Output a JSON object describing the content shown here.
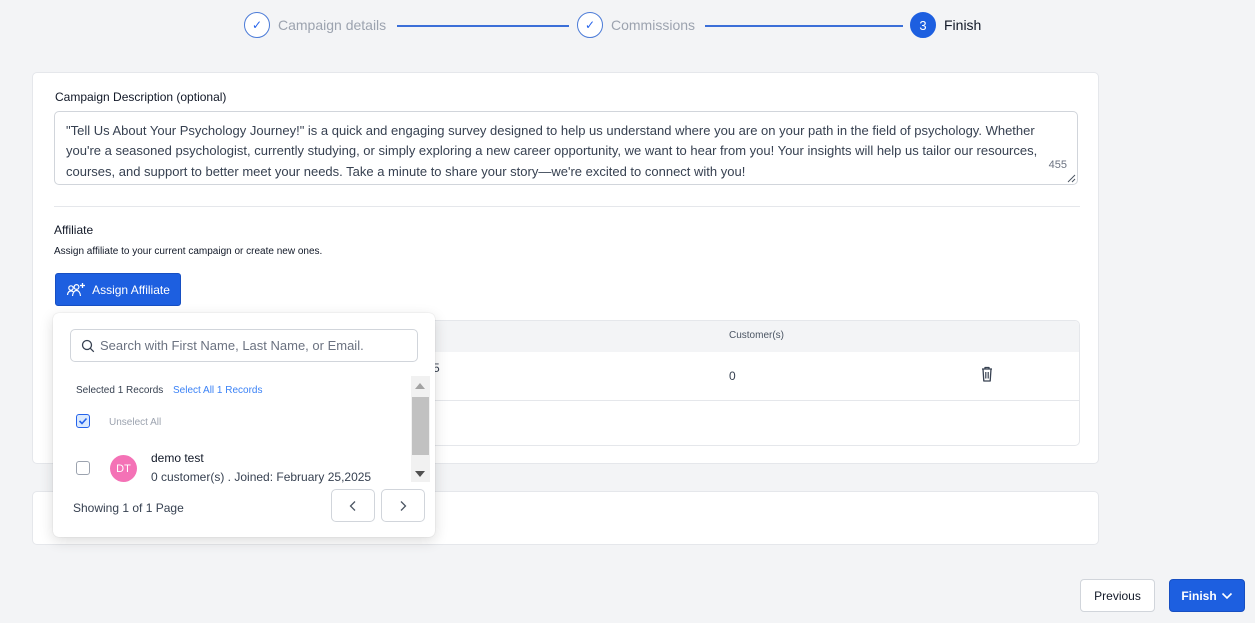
{
  "stepper": {
    "steps": [
      {
        "label": "Campaign details",
        "marker": "✓",
        "state": "done"
      },
      {
        "label": "Commissions",
        "marker": "✓",
        "state": "done"
      },
      {
        "label": "Finish",
        "marker": "3",
        "state": "active"
      }
    ]
  },
  "description": {
    "label": "Campaign Description (optional)",
    "text": "\"Tell Us About Your Psychology Journey!\" is a quick and engaging survey designed to help us understand where you are on your path in the field of psychology. Whether you're a seasoned psychologist, currently studying, or simply exploring a new career opportunity, we want to hear from you! Your insights will help us tailor our resources, courses, and support to better meet your needs. Take a minute to share your story—we're excited to connect with you!",
    "char_count": "455"
  },
  "affiliate": {
    "title": "Affiliate",
    "subtitle": "Assign affiliate to your current campaign or create new ones.",
    "assign_button": "Assign Affiliate",
    "table": {
      "header_customers": "Customer(s)",
      "rows": [
        {
          "truncated_text": "5",
          "customers": "0"
        }
      ]
    }
  },
  "dropdown": {
    "search_placeholder": "Search with First Name, Last Name, or Email.",
    "selected_count": "Selected 1 Records",
    "select_all": "Select All 1 Records",
    "unselect_all": "Unselect All",
    "unselect_checked": true,
    "items": [
      {
        "initials": "DT",
        "name": "demo test",
        "meta": "0 customer(s) . Joined: February 25,2025",
        "checked": false,
        "avatar_color": "#f472b6"
      }
    ],
    "pagination": "Showing 1 of 1 Page"
  },
  "footer": {
    "previous": "Previous",
    "finish": "Finish"
  },
  "colors": {
    "primary": "#1d5fe0",
    "link": "#3b82f6",
    "background": "#f3f4f6"
  }
}
